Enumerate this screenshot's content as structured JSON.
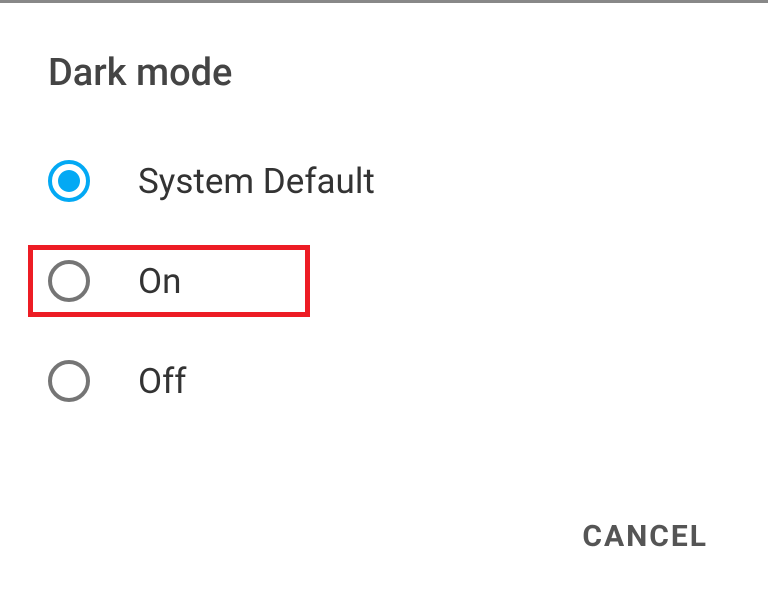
{
  "dialog": {
    "title": "Dark mode",
    "options": [
      {
        "label": "System Default",
        "selected": true,
        "highlighted": false
      },
      {
        "label": "On",
        "selected": false,
        "highlighted": true
      },
      {
        "label": "Off",
        "selected": false,
        "highlighted": false
      }
    ],
    "cancel_label": "CANCEL"
  }
}
